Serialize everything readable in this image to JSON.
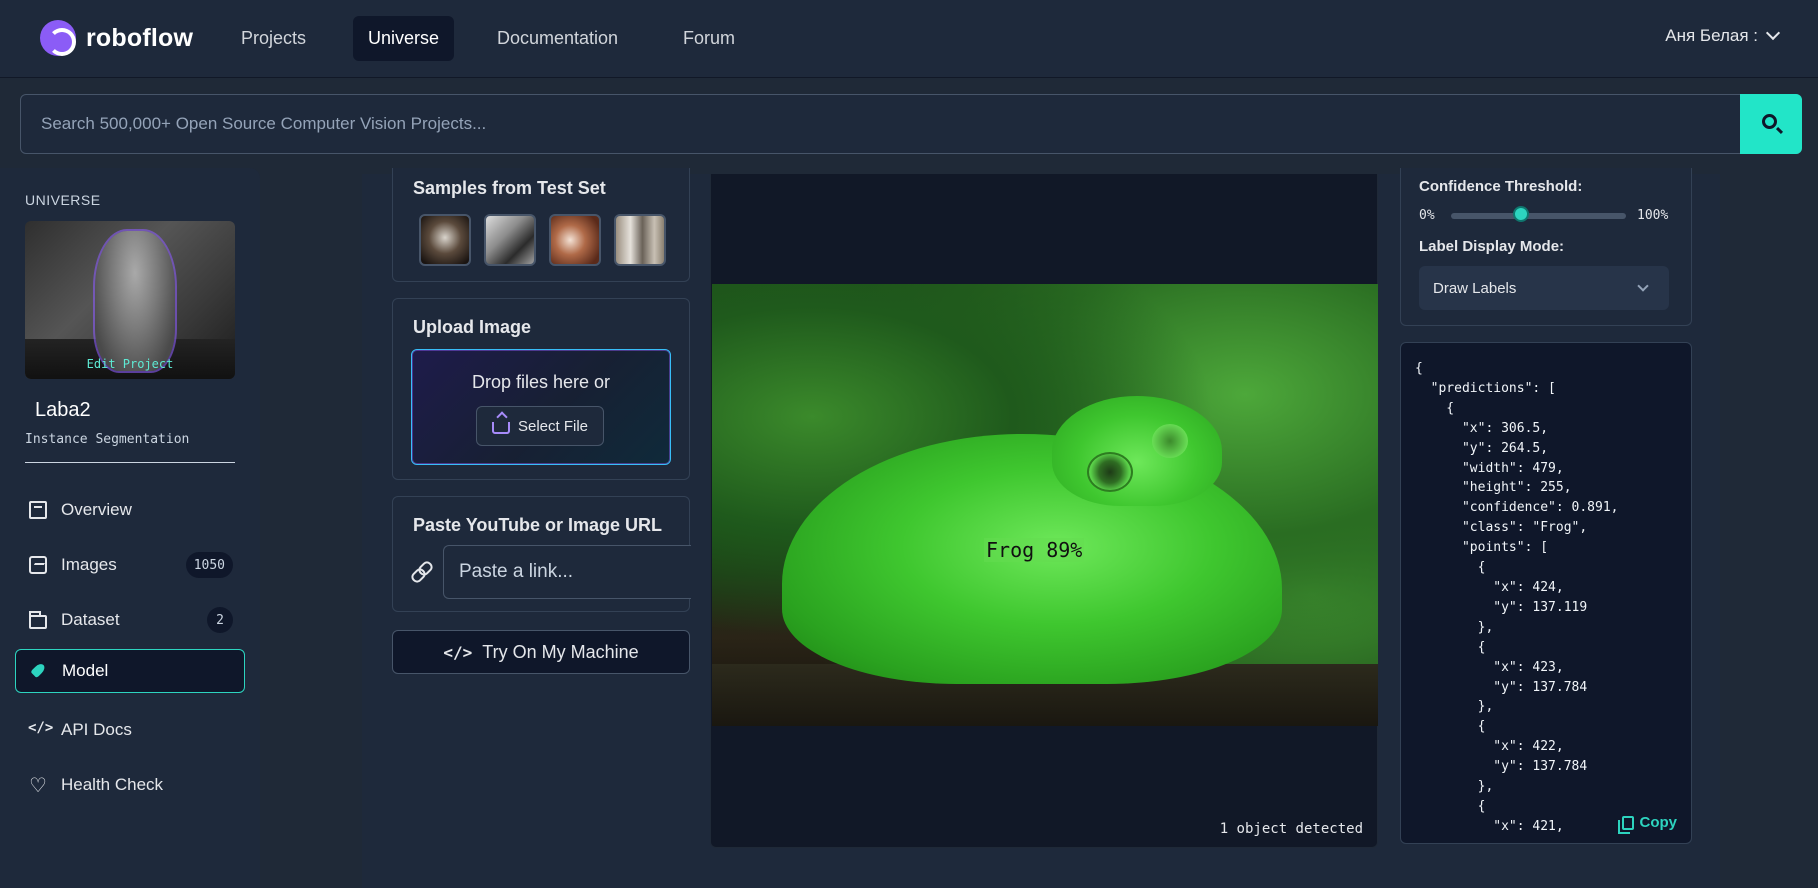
{
  "nav": {
    "logo_text": "roboflow",
    "links": [
      "Projects",
      "Universe",
      "Documentation",
      "Forum"
    ],
    "active": "Universe",
    "user": "Аня Белая :"
  },
  "search": {
    "placeholder": "Search 500,000+ Open Source Computer Vision Projects..."
  },
  "sidebar": {
    "heading": "UNIVERSE",
    "edit_label": "Edit Project",
    "project_name": "Laba2",
    "project_type": "Instance Segmentation",
    "items": [
      {
        "label": "Overview",
        "icon": "book-icon"
      },
      {
        "label": "Images",
        "icon": "images-icon",
        "badge": "1050"
      },
      {
        "label": "Dataset",
        "icon": "folder-icon",
        "badge": "2"
      },
      {
        "label": "Model",
        "icon": "rocket-icon",
        "active": true
      },
      {
        "label": "API Docs",
        "icon": "code-icon"
      },
      {
        "label": "Health Check",
        "icon": "heart-pulse-icon"
      }
    ]
  },
  "samples": {
    "title": "Samples from Test Set"
  },
  "upload": {
    "title": "Upload Image",
    "drop_text": "Drop files here or",
    "select_label": "Select File"
  },
  "paste": {
    "title": "Paste YouTube or Image URL",
    "placeholder": "Paste a link..."
  },
  "try_label": "Try On My Machine",
  "viewer": {
    "prediction_label": "Frog 89%",
    "detected_text": "1 object detected"
  },
  "settings": {
    "confidence_title": "Confidence Threshold:",
    "min_label": "0%",
    "max_label": "100%",
    "confidence_value": 0.4,
    "label_mode_title": "Label Display Mode:",
    "label_mode_value": "Draw Labels"
  },
  "json_output": "{\n  \"predictions\": [\n    {\n      \"x\": 306.5,\n      \"y\": 264.5,\n      \"width\": 479,\n      \"height\": 255,\n      \"confidence\": 0.891,\n      \"class\": \"Frog\",\n      \"points\": [\n        {\n          \"x\": 424,\n          \"y\": 137.119\n        },\n        {\n          \"x\": 423,\n          \"y\": 137.784\n        },\n        {\n          \"x\": 422,\n          \"y\": 137.784\n        },\n        {\n          \"x\": 421,",
  "copy_label": "Copy",
  "colors": {
    "accent": "#2dd4bf",
    "brand": "#8b5cf6",
    "background": "#1f2937"
  }
}
